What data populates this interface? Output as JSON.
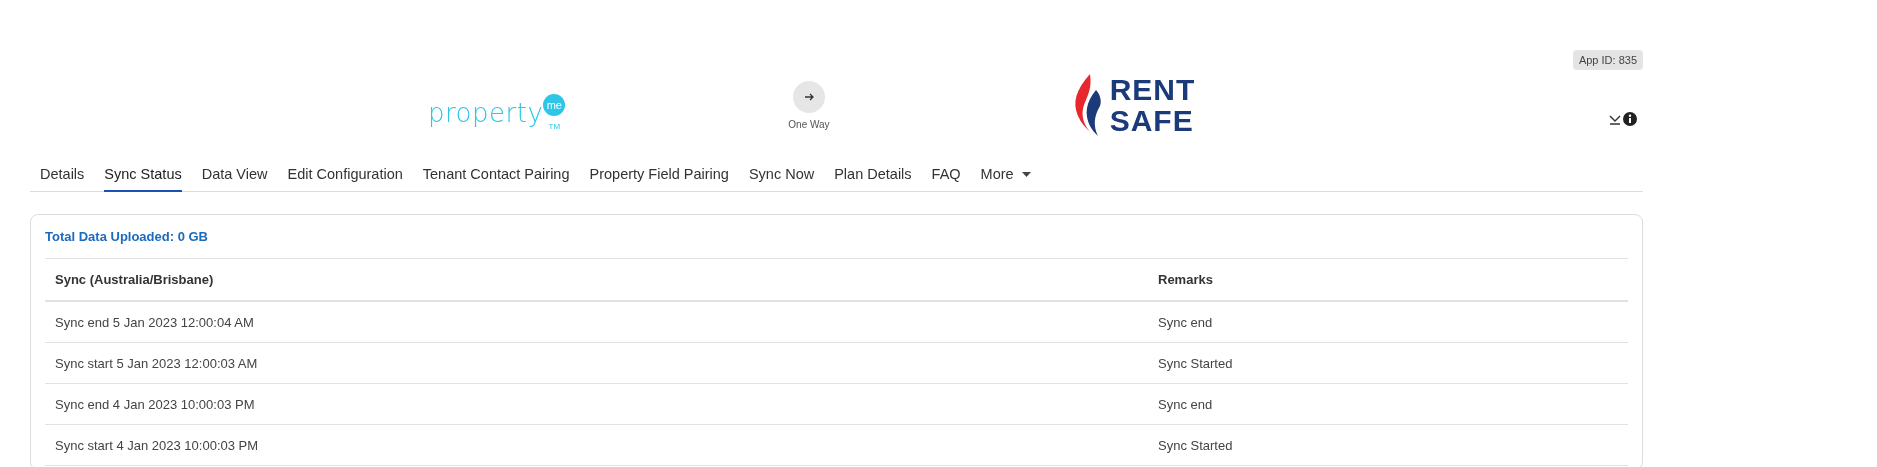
{
  "header": {
    "app_id": "App ID: 835",
    "source_logo": {
      "word": "property",
      "badge": "me",
      "tm": "TM"
    },
    "direction": "One Way",
    "target_logo": {
      "line_1": "RENT",
      "line_2": "SAFE"
    }
  },
  "tabs": [
    {
      "label": "Details",
      "selected": false
    },
    {
      "label": "Sync Status",
      "selected": true
    },
    {
      "label": "Data View",
      "selected": false
    },
    {
      "label": "Edit Configuration",
      "selected": false
    },
    {
      "label": "Tenant Contact Pairing",
      "selected": false
    },
    {
      "label": "Property Field Pairing",
      "selected": false
    },
    {
      "label": "Sync Now",
      "selected": false
    },
    {
      "label": "Plan Details",
      "selected": false
    },
    {
      "label": "FAQ",
      "selected": false
    },
    {
      "label": "More",
      "selected": false,
      "kind": "dropdown"
    }
  ],
  "summary": "Total Data Uploaded: 0 GB",
  "table": {
    "columns": [
      "Sync (Australia/Brisbane)",
      "Remarks"
    ],
    "rows": [
      [
        "Sync end 5 Jan 2023 12:00:04 AM",
        "Sync end"
      ],
      [
        "Sync start 5 Jan 2023 12:00:03 AM",
        "Sync Started"
      ],
      [
        "Sync end 4 Jan 2023 10:00:03 PM",
        "Sync end"
      ],
      [
        "Sync start 4 Jan 2023 10:00:03 PM",
        "Sync Started"
      ]
    ]
  }
}
